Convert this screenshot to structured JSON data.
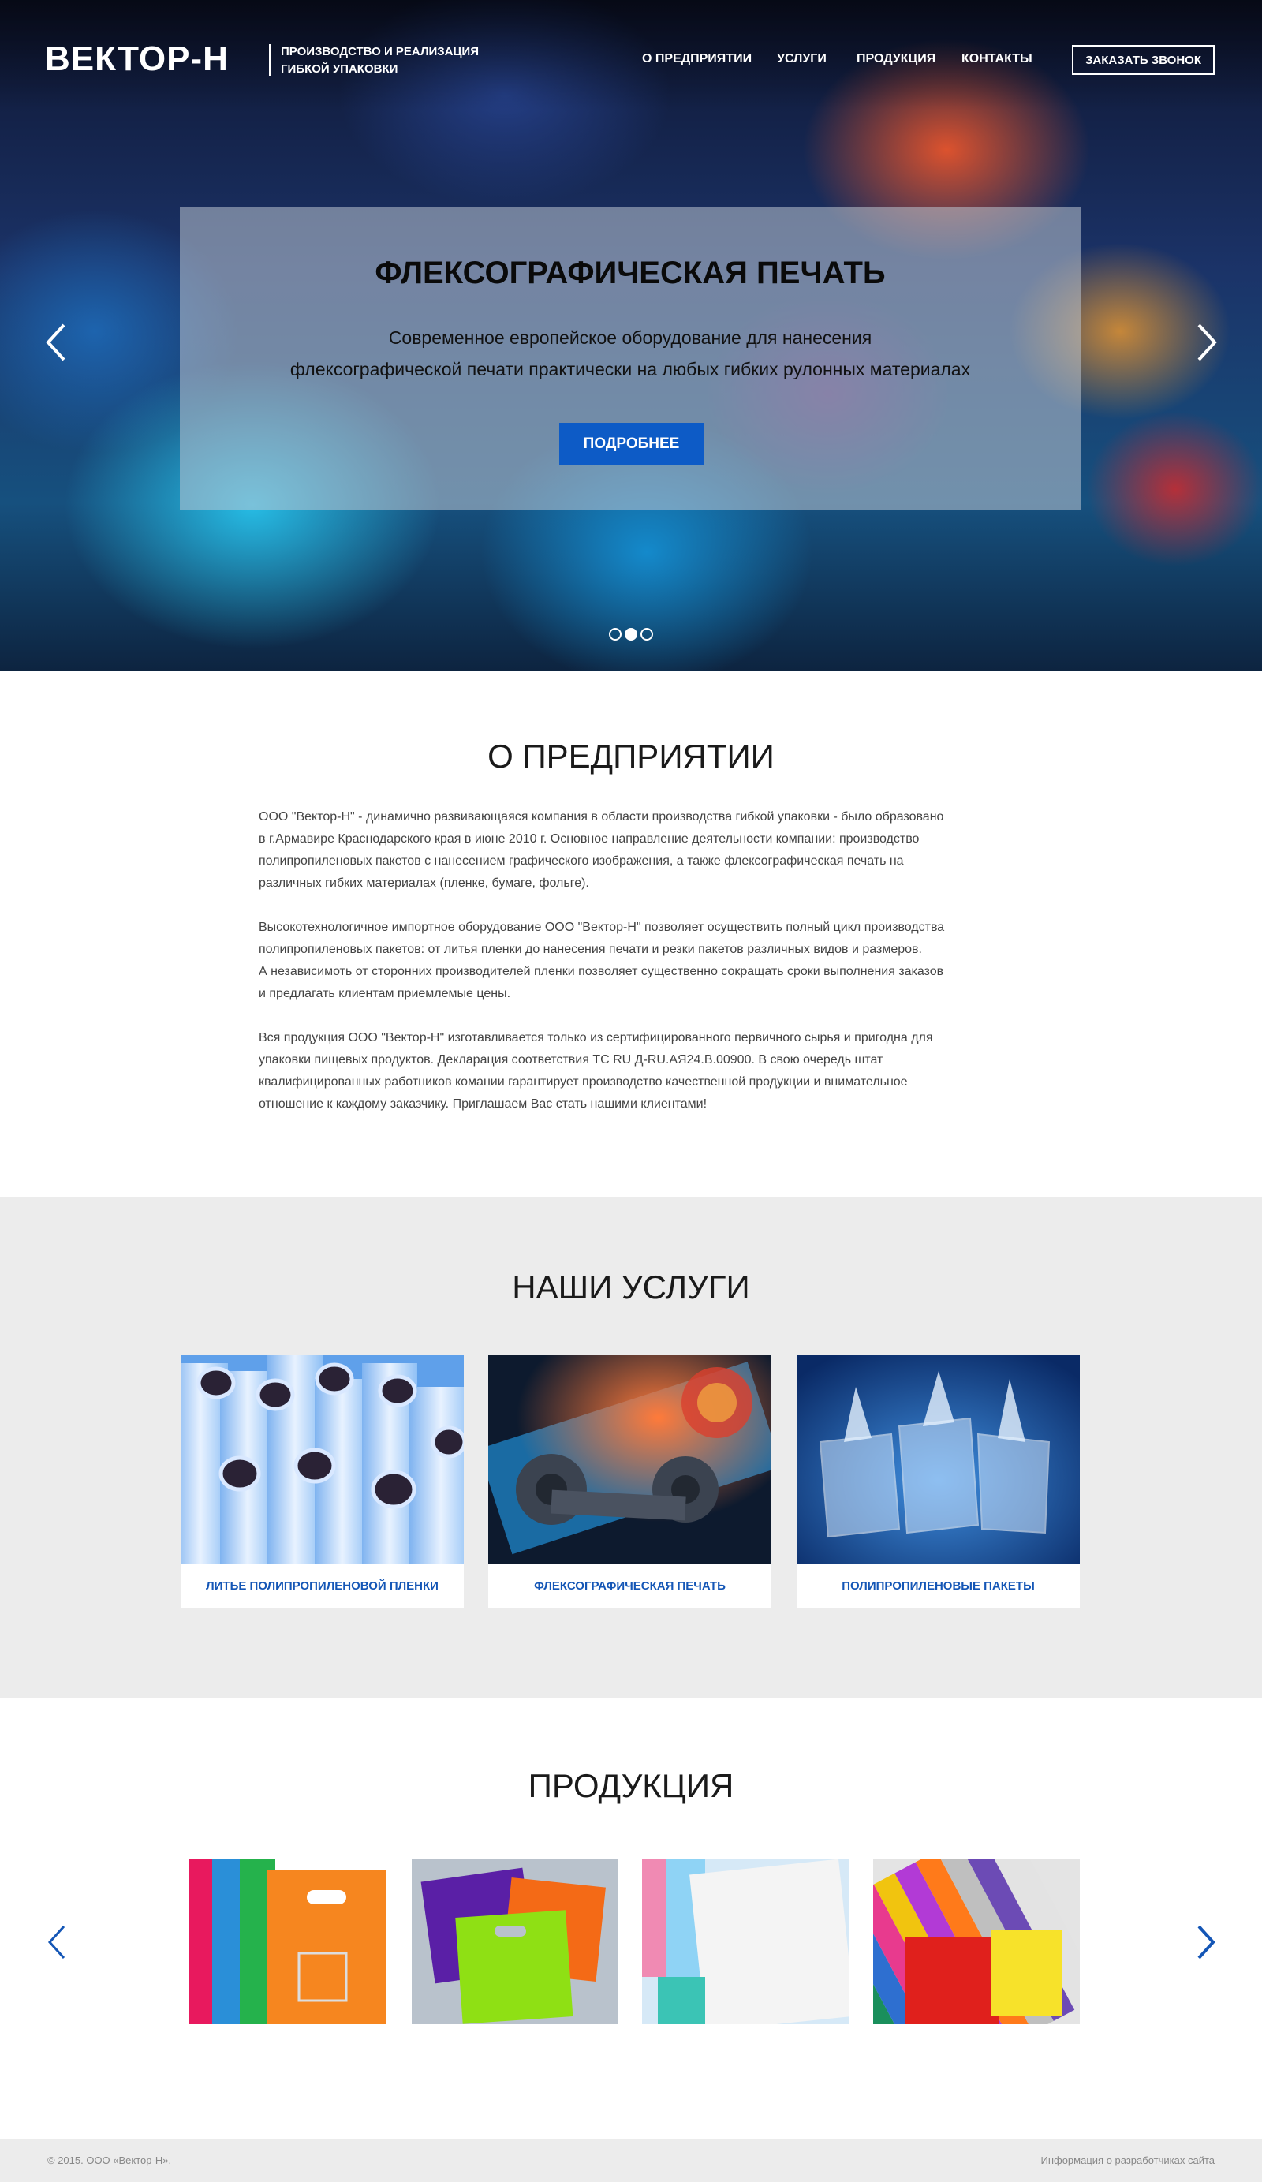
{
  "header": {
    "logo": "ВЕКТОР-Н",
    "tagline_line1": "ПРОИЗВОДСТВО И РЕАЛИЗАЦИЯ",
    "tagline_line2": "ГИБКОЙ УПАКОВКИ",
    "nav": [
      "О ПРЕДПРИЯТИИ",
      "УСЛУГИ",
      "ПРОДУКЦИЯ",
      "КОНТАКТЫ"
    ],
    "cta": "ЗАКАЗАТЬ ЗВОНОК"
  },
  "hero": {
    "title": "ФЛЕКСОГРАФИЧЕСКАЯ ПЕЧАТЬ",
    "subtitle_line1": "Современное европейское оборудование для нанесения",
    "subtitle_line2": "флексографической печати практически на любых гибких рулонных материалах",
    "button": "ПОДРОБНЕЕ",
    "slide_count": 3,
    "active_slide": 2
  },
  "about": {
    "title": "О ПРЕДПРИЯТИИ",
    "paragraphs": [
      [
        "ООО \"Вектор-Н\" - динамично развивающаяся компания в области производства гибкой упаковки - было образовано",
        "в г.Армавире Краснодарского края в июне 2010 г. Основное направление деятельности компании: производство",
        "полипропиленовых пакетов с нанесением графического изображения, а также флексографическая печать на",
        "различных гибких материалах (пленке, бумаге, фольге)."
      ],
      [
        "Высокотехнологичное импортное оборудование ООО \"Вектор-Н\"  позволяет осуществить полный цикл производства",
        "полипропиленовых пакетов: от литья пленки до нанесения печати и резки пакетов различных видов и размеров.",
        "А независимоть от сторонних производителей пленки позволяет существенно сокращать сроки выполнения заказов",
        "и предлагать клиентам приемлемые цены."
      ],
      [
        "Вся продукция ООО \"Вектор-Н\" изготавливается только из сертифицированного первичного сырья и пригодна для",
        "упаковки пищевых продуктов. Декларация соответствия ТС RU Д-RU.АЯ24.В.00900. В свою очередь штат",
        "квалифицированных работников комании гарантирует производство качественной продукции и внимательное",
        "отношение к каждому заказчику. Приглашаем Вас стать нашими клиентами!"
      ]
    ]
  },
  "services": {
    "title": "НАШИ УСЛУГИ",
    "items": [
      "ЛИТЬЕ ПОЛИПРОПИЛЕНОВОЙ ПЛЕНКИ",
      "ФЛЕКСОГРАФИЧЕСКАЯ ПЕЧАТЬ",
      "ПОЛИПРОПИЛЕНОВЫЕ ПАКЕТЫ"
    ]
  },
  "products": {
    "title": "ПРОДУКЦИЯ",
    "count": 4
  },
  "footer": {
    "copyright": "© 2015. ООО «Вектор-Н».",
    "developer_link": "Информация о разработчиках сайта"
  },
  "colors": {
    "accent_blue": "#0d5bc6",
    "link_blue": "#1456b6",
    "section_gray": "#ececec"
  },
  "icons": [
    "chevron-left-icon",
    "chevron-right-icon"
  ]
}
